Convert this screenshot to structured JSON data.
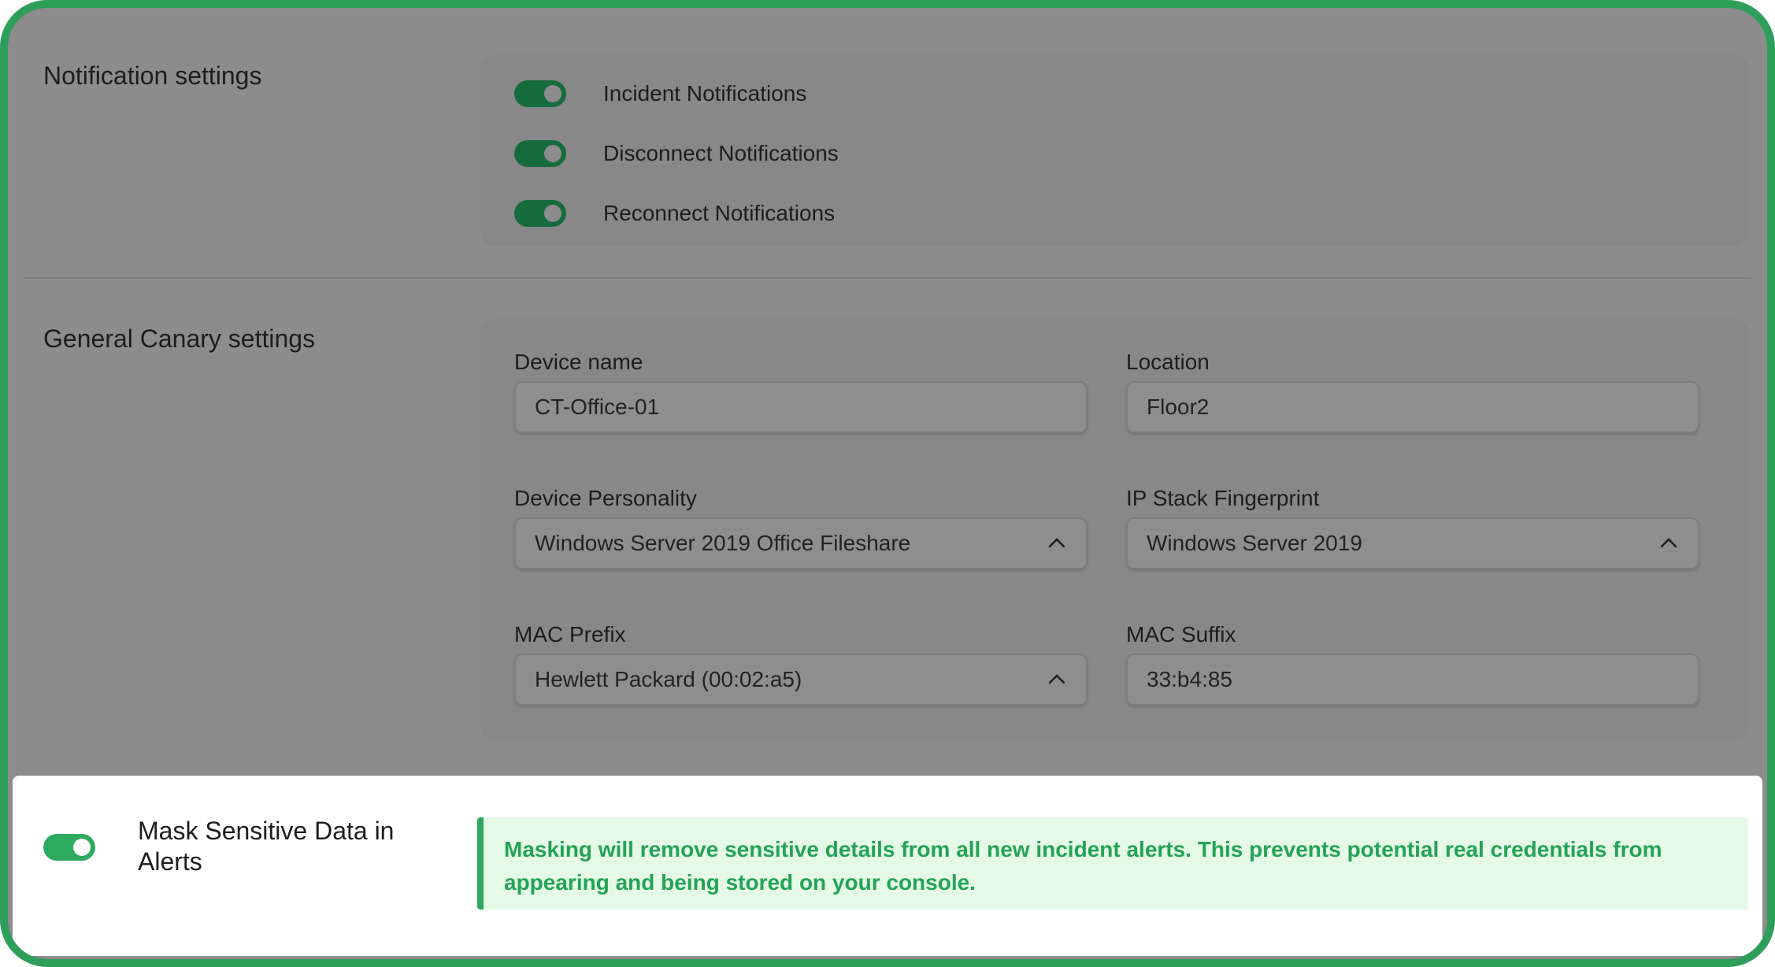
{
  "notification_settings": {
    "title": "Notification settings",
    "toggles": [
      {
        "label": "Incident Notifications",
        "on": true
      },
      {
        "label": "Disconnect Notifications",
        "on": true
      },
      {
        "label": "Reconnect Notifications",
        "on": true
      }
    ]
  },
  "general_settings": {
    "title": "General Canary settings",
    "device_name": {
      "label": "Device name",
      "value": "CT-Office-01"
    },
    "location": {
      "label": "Location",
      "value": "Floor2"
    },
    "device_personality": {
      "label": "Device Personality",
      "value": "Windows Server 2019 Office Fileshare",
      "icon": "chevron-up-icon"
    },
    "ip_stack_fingerprint": {
      "label": "IP Stack Fingerprint",
      "value": "Windows Server 2019",
      "icon": "chevron-up-icon"
    },
    "mac_prefix": {
      "label": "MAC Prefix",
      "value": "Hewlett Packard (00:02:a5)",
      "icon": "chevron-up-icon"
    },
    "mac_suffix": {
      "label": "MAC Suffix",
      "value": "33:b4:85"
    }
  },
  "mask_sensitive": {
    "label": "Mask Sensitive Data in Alerts",
    "on": true,
    "info": "Masking will remove sensitive details from all new incident alerts. This prevents potential real credentials from appearing and being stored on your console."
  },
  "colors": {
    "accent_green": "#2daa5f",
    "info_background": "#e4f9e6",
    "frame_border": "#2f9e5a",
    "overlay_gray": "#8c8c8c"
  }
}
